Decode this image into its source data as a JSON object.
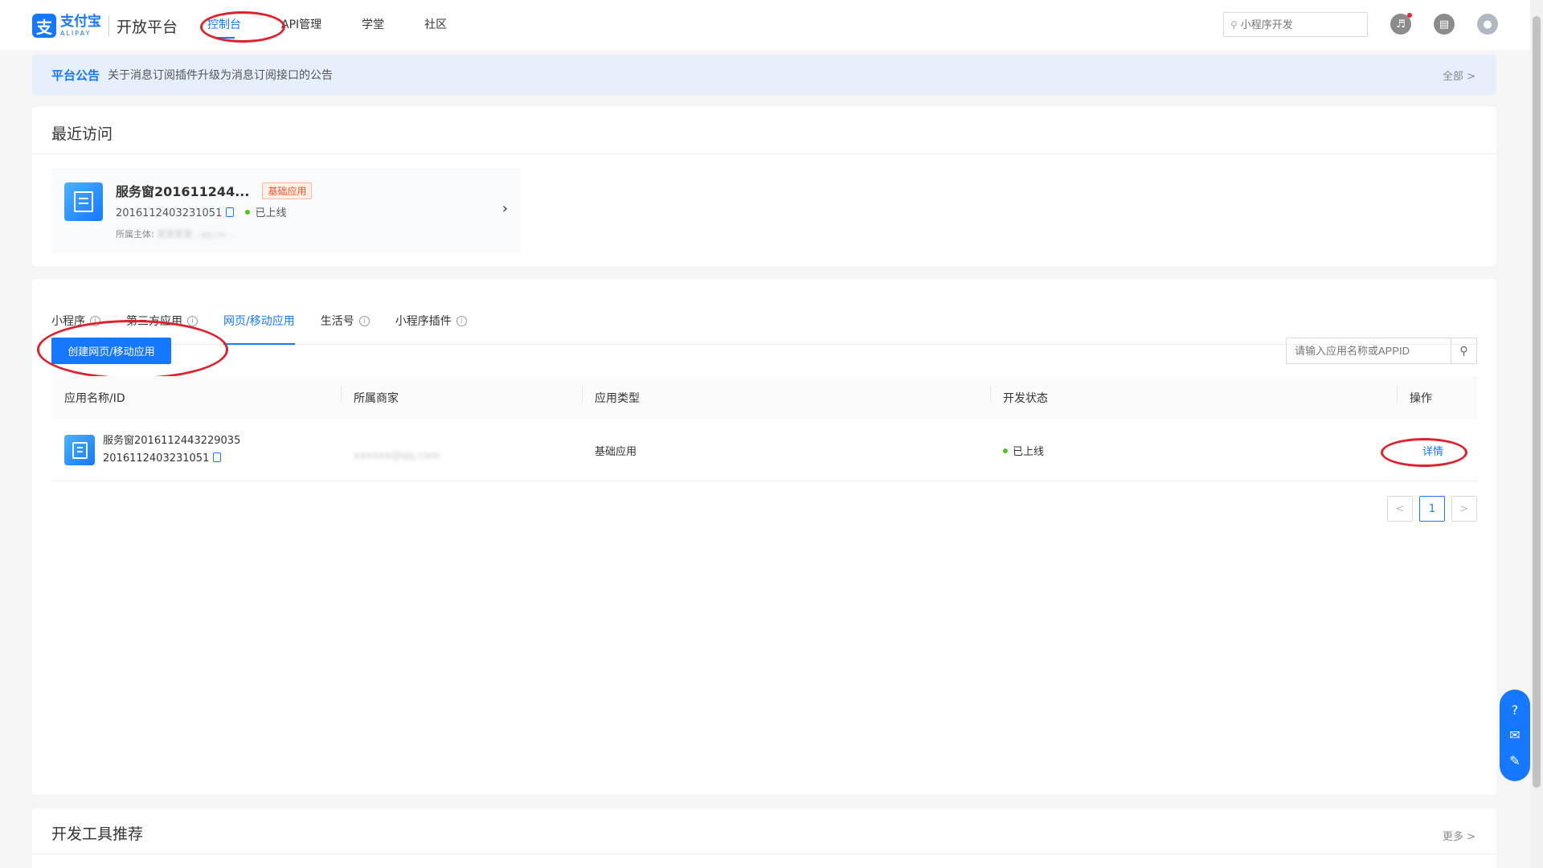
{
  "header": {
    "logo_cn": "支付宝",
    "logo_en": "ALIPAY",
    "platform": "开放平台",
    "nav": [
      {
        "label": "控制台",
        "active": true
      },
      {
        "label": "API管理"
      },
      {
        "label": "学堂"
      },
      {
        "label": "社区"
      }
    ],
    "search_placeholder": "小程序开发",
    "icons": [
      "bell-icon",
      "document-icon",
      "user-avatar-icon"
    ]
  },
  "announcement": {
    "tag": "平台公告",
    "text": "关于消息订阅插件升级为消息订阅接口的公告",
    "all_label": "全部 >"
  },
  "recent": {
    "title": "最近访问",
    "item": {
      "name": "服务窗201611244...",
      "tag": "基础应用",
      "appid": "2016112403231051",
      "status": "已上线",
      "owner_label": "所属主体:",
      "owner_value": "某某某某...qq.co..."
    }
  },
  "apps": {
    "tabs": [
      {
        "label": "小程序",
        "info": true
      },
      {
        "label": "第三方应用",
        "info": true
      },
      {
        "label": "网页/移动应用",
        "active": true
      },
      {
        "label": "生活号",
        "info": true
      },
      {
        "label": "小程序插件",
        "info": true
      }
    ],
    "create_label": "创建网页/移动应用",
    "search_placeholder": "请输入应用名称或APPID",
    "columns": [
      "应用名称/ID",
      "所属商家",
      "应用类型",
      "开发状态",
      "操作"
    ],
    "rows": [
      {
        "name": "服务窗2016112443229035",
        "appid": "2016112403231051",
        "merchant": "xxxxxx@qq.com",
        "type": "基础应用",
        "status": "已上线",
        "action": "详情"
      }
    ],
    "pagination": {
      "prev": "<",
      "current": "1",
      "next": ">"
    }
  },
  "tools": {
    "title": "开发工具推荐",
    "more_label": "更多 >"
  },
  "float_bar": [
    "help-icon",
    "chat-icon",
    "feedback-icon"
  ]
}
